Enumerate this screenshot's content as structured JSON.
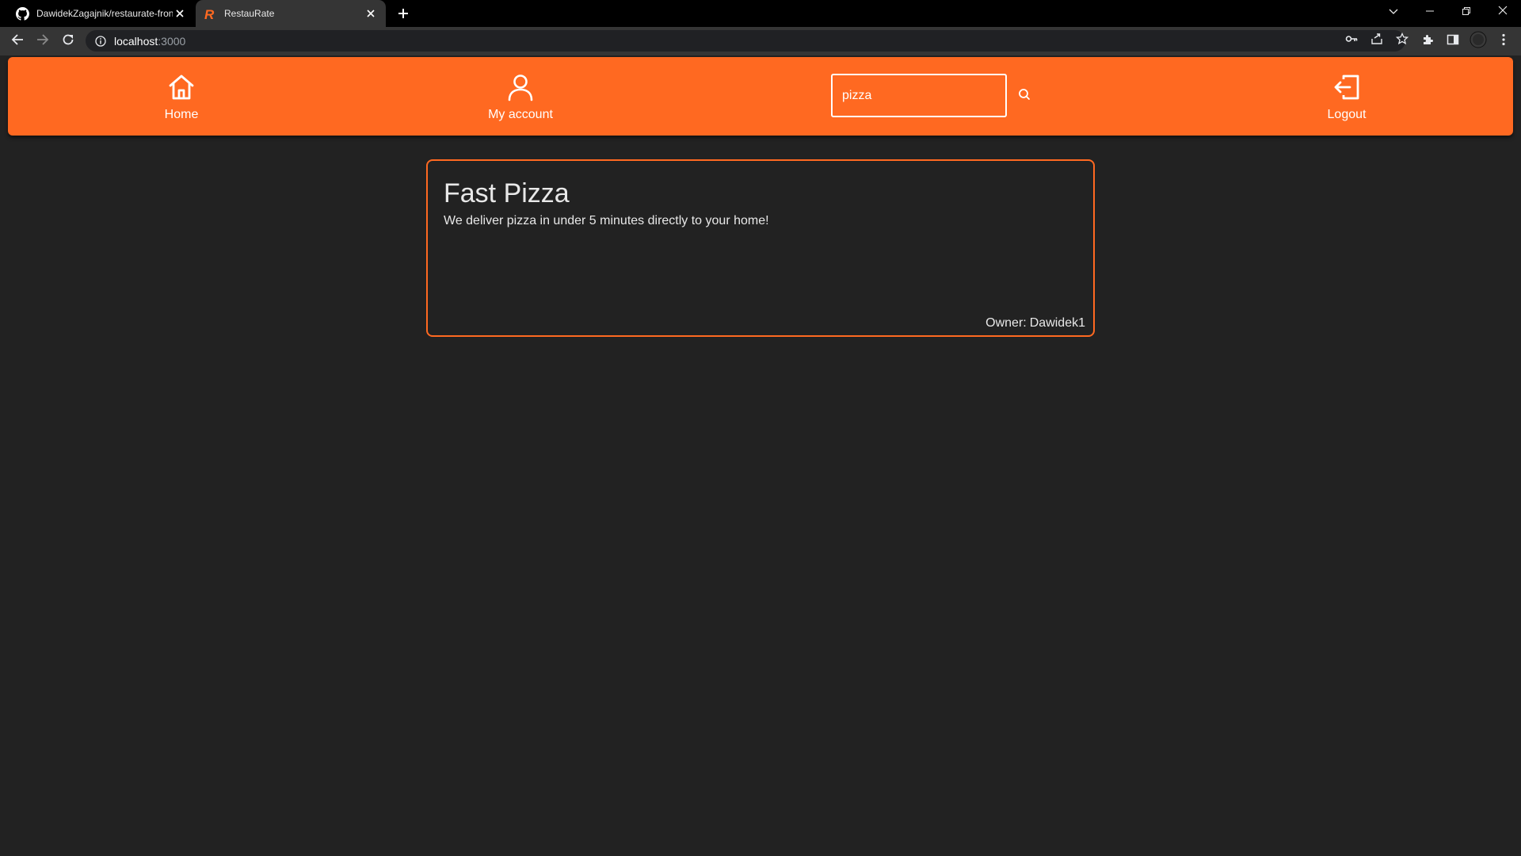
{
  "browser": {
    "tabs": [
      {
        "title": "DawidekZagajnik/restaurate-fron",
        "favicon": "github-icon",
        "active": false
      },
      {
        "title": "RestauRate",
        "favicon": "restaurate-logo-icon",
        "active": true
      }
    ],
    "url_host": "localhost",
    "url_port": ":3000"
  },
  "nav": {
    "home_label": "Home",
    "account_label": "My account",
    "logout_label": "Logout",
    "search_value": "pizza"
  },
  "colors": {
    "accent": "#ff6921",
    "background": "#222222"
  },
  "results": [
    {
      "name": "Fast Pizza",
      "description": "We deliver pizza in under 5 minutes directly to your home!",
      "owner_label": "Owner:",
      "owner": "Dawidek1"
    }
  ]
}
